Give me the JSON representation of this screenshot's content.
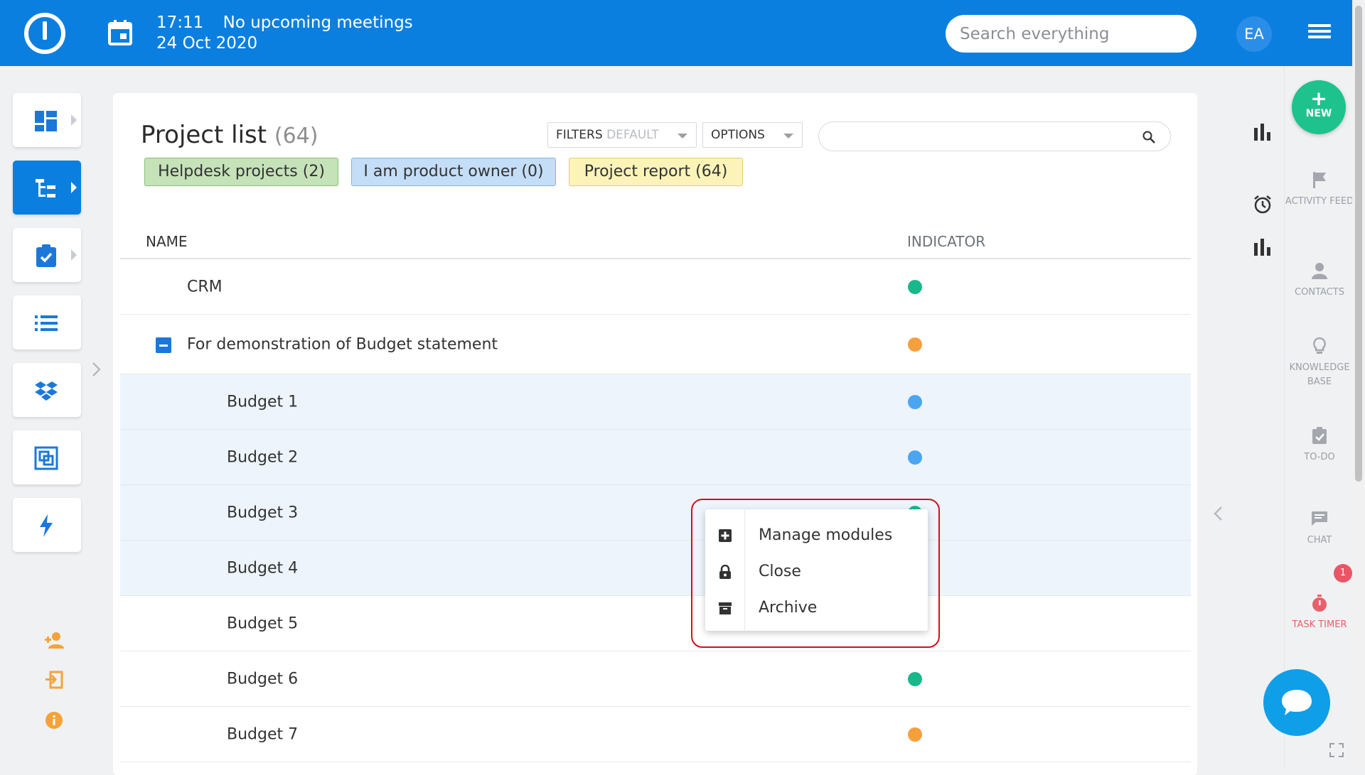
{
  "header": {
    "time": "17:11",
    "meetings": "No upcoming meetings",
    "date": "24 Oct 2020",
    "search_placeholder": "Search everything",
    "avatar_initials": "EA",
    "brand_color": "#0b7fe0"
  },
  "left_nav": {
    "items": [
      {
        "icon": "dashboard-icon"
      },
      {
        "icon": "project-tree-icon",
        "active": true
      },
      {
        "icon": "task-clipboard-icon"
      },
      {
        "icon": "list-icon"
      },
      {
        "icon": "dropbox-icon"
      },
      {
        "icon": "resource-icon"
      },
      {
        "icon": "lightning-icon"
      }
    ],
    "bottom_icons": [
      "add-user-icon",
      "sign-in-icon",
      "info-icon"
    ]
  },
  "main": {
    "title": "Project list",
    "count": "(64)",
    "filters_label": "FILTERS",
    "filters_value": "DEFAULT",
    "options_label": "OPTIONS",
    "search_placeholder": "",
    "quick_filters": [
      {
        "label": "Helpdesk projects (2)",
        "color": "#c5e2b9"
      },
      {
        "label": "I am product owner (0)",
        "color": "#c5def7"
      },
      {
        "label": "Project report (64)",
        "color": "#fcf3b9"
      }
    ],
    "columns": {
      "name": "NAME",
      "indicator": "INDICATOR"
    },
    "rows": [
      {
        "name": "CRM",
        "indicator": "green"
      },
      {
        "name": "For demonstration of Budget statement",
        "indicator": "orange",
        "expanded": true
      },
      {
        "name": "Budget 1",
        "indicator": "blue"
      },
      {
        "name": "Budget 2",
        "indicator": "blue"
      },
      {
        "name": "Budget 3",
        "indicator": "green"
      },
      {
        "name": "Budget 4",
        "indicator": ""
      },
      {
        "name": "Budget 5",
        "indicator": ""
      },
      {
        "name": "Budget 6",
        "indicator": "green"
      },
      {
        "name": "Budget 7",
        "indicator": "orange"
      }
    ]
  },
  "context_menu": {
    "items": [
      {
        "label": "Manage modules",
        "icon": "plus-square-icon"
      },
      {
        "label": "Close",
        "icon": "lock-icon"
      },
      {
        "label": "Archive",
        "icon": "archive-icon"
      }
    ],
    "highlight_color": "#d0101c"
  },
  "right_sidebar": {
    "new_label": "NEW",
    "items": [
      {
        "label": "ACTIVITY FEED",
        "icon": "flag-icon"
      },
      {
        "label": "CONTACTS",
        "icon": "person-icon"
      },
      {
        "label": "KNOWLEDGE BASE",
        "icon": "lightbulb-icon"
      },
      {
        "label": "TO-DO",
        "icon": "checklist-icon"
      },
      {
        "label": "CHAT",
        "icon": "chat-bubble-icon"
      },
      {
        "label": "TASK TIMER",
        "icon": "stopwatch-icon"
      }
    ],
    "timer_badge": "1"
  },
  "indicator_colors": {
    "green": "#19b88a",
    "orange": "#f5a03c",
    "blue": "#4aa6f0"
  }
}
